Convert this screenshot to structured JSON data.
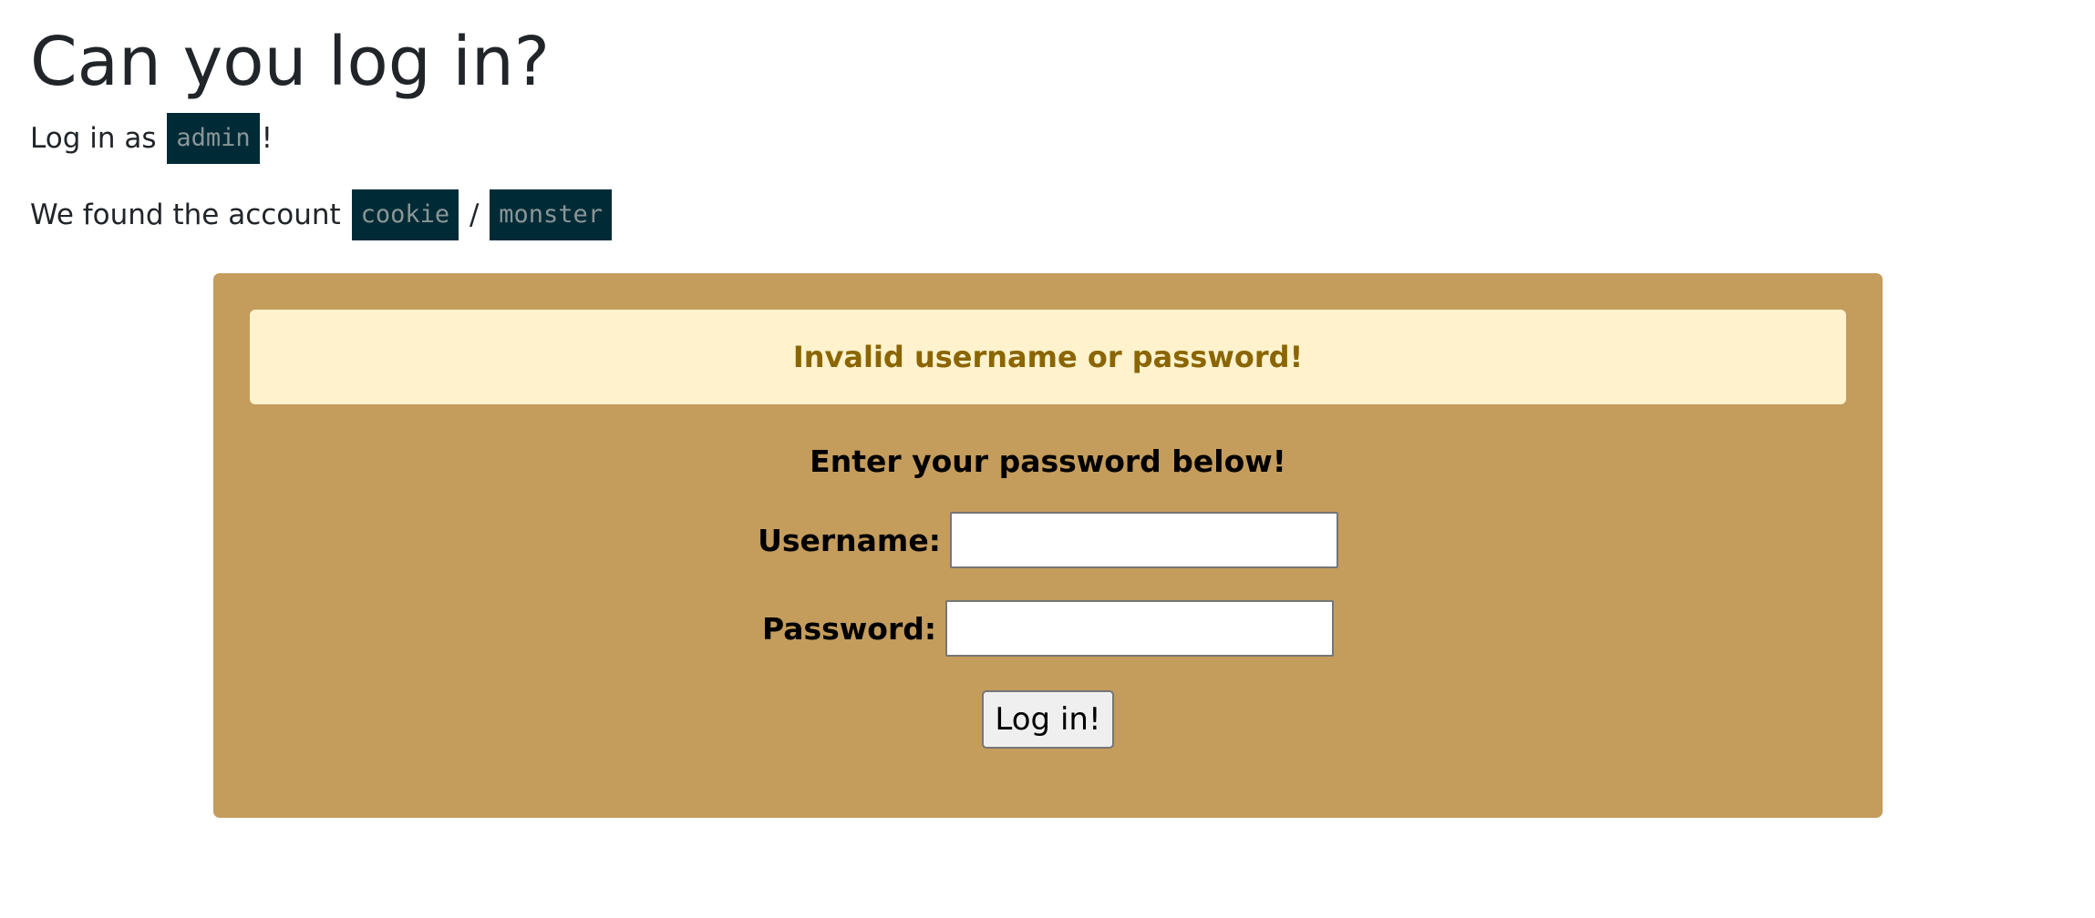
{
  "header": {
    "title": "Can you log in?",
    "login_prefix": "Log in as",
    "login_user": "admin",
    "login_suffix": "!",
    "found_prefix": "We found the account",
    "found_user": "cookie",
    "found_sep": "/",
    "found_pass": "monster"
  },
  "panel": {
    "background": "#c49c5c",
    "alert_text": "Invalid username or password!",
    "alert_color": "#8a6500",
    "alert_background": "#fff2cc",
    "prompt": "Enter your password below!",
    "username_label": "Username:",
    "username_value": "",
    "password_label": "Password:",
    "password_value": "",
    "submit_label": "Log in!"
  },
  "colors": {
    "code_background": "#002b36",
    "code_text": "#8a9597"
  }
}
